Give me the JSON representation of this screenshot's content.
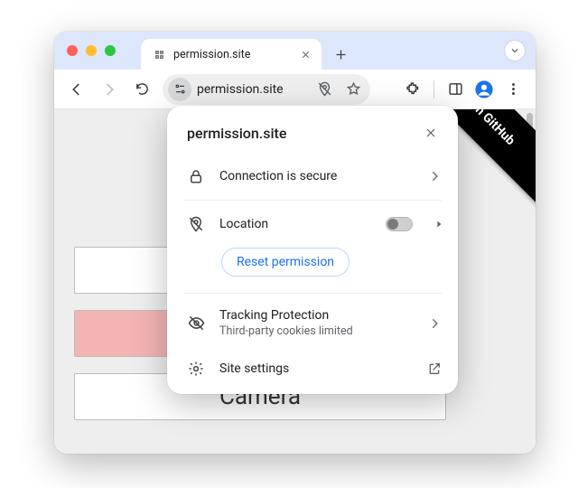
{
  "tab": {
    "title": "permission.site"
  },
  "omnibox": {
    "url": "permission.site"
  },
  "popover": {
    "title": "permission.site",
    "connection_label": "Connection is secure",
    "location_label": "Location",
    "reset_label": "Reset permission",
    "tracking_label": "Tracking Protection",
    "tracking_sub": "Third-party cookies limited",
    "site_settings_label": "Site settings"
  },
  "ribbon": {
    "text": "n GitHub"
  },
  "page": {
    "button3": "Camera"
  }
}
